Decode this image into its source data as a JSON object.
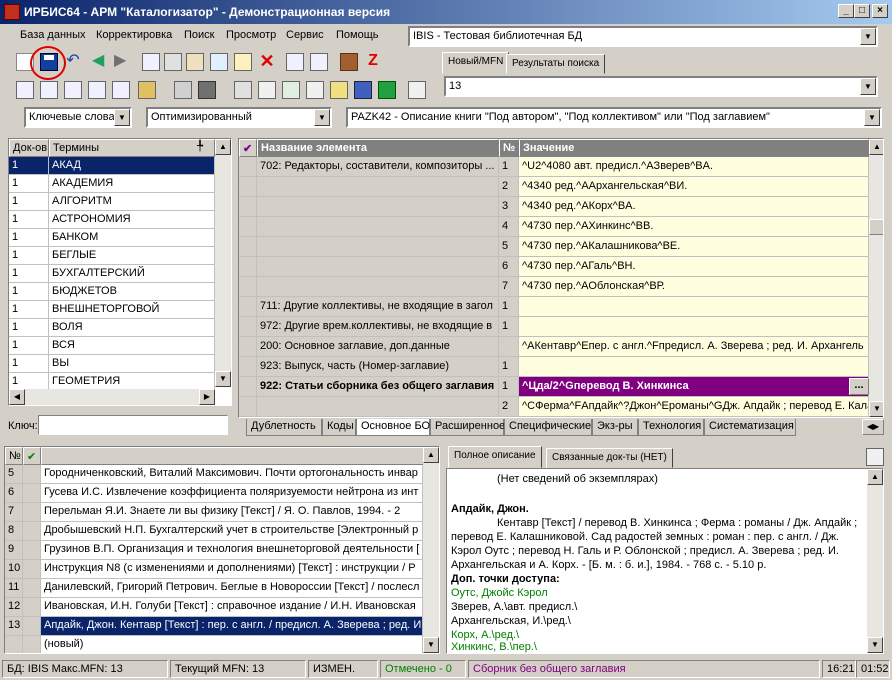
{
  "window": {
    "title": "ИРБИС64 - АРМ \"Каталогизатор\" - Демонстрационная версия",
    "min": "_",
    "max": "□",
    "close": "×"
  },
  "menu": [
    "База данных",
    "Корректировка",
    "Поиск",
    "Просмотр",
    "Сервис",
    "Помощь"
  ],
  "db_combo": "IBIS - Тестовая библиотечная БД",
  "right_tabs": [
    "Новый/MFN",
    "Результаты поиска"
  ],
  "mfn_value": "13",
  "search_bar": {
    "mode": "Ключевые слова",
    "opt": "Оптимизированный",
    "template": "PAZK42 - Описание книги \"Под автором\", \"Под коллективом\" или \"Под заглавием\""
  },
  "terms": {
    "headers": [
      "Док-ов",
      "Термины"
    ],
    "rows": [
      [
        "1",
        "АКАД"
      ],
      [
        "1",
        "АКАДЕМИЯ"
      ],
      [
        "1",
        "АЛГОРИТМ"
      ],
      [
        "1",
        "АСТРОНОМИЯ"
      ],
      [
        "1",
        "БАНКОМ"
      ],
      [
        "1",
        "БЕГЛЫЕ"
      ],
      [
        "1",
        "БУХГАЛТЕРСКИЙ"
      ],
      [
        "1",
        "БЮДЖЕТОВ"
      ],
      [
        "1",
        "ВНЕШНЕТОРГОВОЙ"
      ],
      [
        "1",
        "ВОЛЯ"
      ],
      [
        "1",
        "ВСЯ"
      ],
      [
        "1",
        "ВЫ"
      ],
      [
        "1",
        "ГЕОМЕТРИЯ"
      ]
    ],
    "key_label": "Ключ:"
  },
  "editor": {
    "headers": [
      "Название элемента",
      "№",
      "Значение"
    ],
    "rows": [
      {
        "name": "702: Редакторы, составители, композиторы ...",
        "n": "1",
        "v": "^U2^4080 авт. предисл.^AЗверев^BA."
      },
      {
        "name": "",
        "n": "2",
        "v": "^4340 ред.^AАрхангельская^BИ."
      },
      {
        "name": "",
        "n": "3",
        "v": "^4340 ред.^AКорх^BA."
      },
      {
        "name": "",
        "n": "4",
        "v": "^4730 пер.^AХинкинс^BB."
      },
      {
        "name": "",
        "n": "5",
        "v": "^4730 пер.^AКалашникова^BE."
      },
      {
        "name": "",
        "n": "6",
        "v": "^4730 пер.^AГаль^BН."
      },
      {
        "name": "",
        "n": "7",
        "v": "^4730 пер.^AОблонская^BР."
      },
      {
        "name": "711: Другие коллективы, не входящие в загол",
        "n": "1",
        "v": ""
      },
      {
        "name": "972: Другие врем.коллективы, не входящие в",
        "n": "1",
        "v": ""
      },
      {
        "name": "200: Основное заглавие, доп.данные",
        "n": "",
        "v": "^AКентавр^Eпер. с англ.^Fпредисл. А. Зверева ; ред. И. Архангель"
      },
      {
        "name": "923: Выпуск, часть (Номер-заглавие)",
        "n": "1",
        "v": ""
      },
      {
        "name": "922: Статьи сборника без общего заглавия",
        "n": "1",
        "v": "^Цда/2^Gперевод В. Хинкинса"
      },
      {
        "name": "",
        "n": "2",
        "v": "^CФерма^FАпдайк^?Джон^Eроманы^GДж. Апдайк ; перевод Е. Кала"
      }
    ],
    "tabs": [
      "Дублетность",
      "Коды",
      "Основное БО",
      "Расширенное",
      "Специфические",
      "Экз-ры",
      "Технология",
      "Систематизация"
    ],
    "ellipsis": "..."
  },
  "records": {
    "rows": [
      [
        "5",
        "Городниченковский, Виталий Максимович. Почти ортогональность инвар"
      ],
      [
        "6",
        "Гусева И.С. Извлечение коэффициента поляризуемости нейтрона из инт"
      ],
      [
        "7",
        "Перельман Я.И. Знаете ли вы физику [Текст] / Я. О. Павлов, 1994. - 2"
      ],
      [
        "8",
        "Дробышевский Н.П. Бухгалтерский учет в строительстве [Электронный р"
      ],
      [
        "9",
        "Грузинов В.П. Организация и технология внешнеторговой деятельности ["
      ],
      [
        "10",
        "Инструкция N8  (с изменениями и дополнениями) [Текст] : инструкции / Р"
      ],
      [
        "11",
        "Данилевский, Григорий Петрович. Беглые в Новороссии [Текст] / послесл"
      ],
      [
        "12",
        "Ивановская, И.Н. Голуби [Текст] : справочное издание / И.Н. Ивановская"
      ],
      [
        "13",
        "Апдайк, Джон. Кентавр [Текст] : пер. с англ. / предисл. А. Зверева ; ред. И"
      ],
      [
        "",
        "(новый)"
      ]
    ],
    "header_n": "№",
    "header_check": "✔"
  },
  "preview": {
    "tabs": [
      "Полное описание",
      "Связанные док-ты (НЕТ)"
    ],
    "lines": [
      "(Нет сведений об экземплярах)",
      "Апдайк, Джон.",
      "Кентавр [Текст] / перевод В. Хинкинса ; Ферма : романы / Дж. Апдайк ;",
      "перевод Е. Калашниковой. Сад радостей земных : роман : пер. с англ. / Дж.",
      "Кэрол Оутс ; перевод Н. Галь и Р. Облонской ; предисл. А. Зверева ; ред. И.",
      "Архангельская и А. Корх. - [Б. м. : б. и.], 1984. - 768 с. - 5.10 р.",
      "Доп. точки доступа:",
      "Оутс, Джойс Кэрол",
      "Зверев, А.\\авт. предисл.\\",
      "Архангельская, И.\\ред.\\",
      "Корх, А.\\ред.\\",
      "Хинкинс, В.\\пер.\\"
    ]
  },
  "status": {
    "db": "БД: IBIS Макс.MFN: 13",
    "cur": "Текущий MFN: 13",
    "changed": "ИЗМЕН.",
    "marked": "Отмечено - 0",
    "ws": "Сборник без общего заглавия",
    "time1": "16:21",
    "time2": "01:52"
  },
  "colors": {
    "accent": "#0a246a",
    "selected_row": "#0a246a",
    "highlight_row": "#800080",
    "yellow_cell": "#ffffe0"
  }
}
